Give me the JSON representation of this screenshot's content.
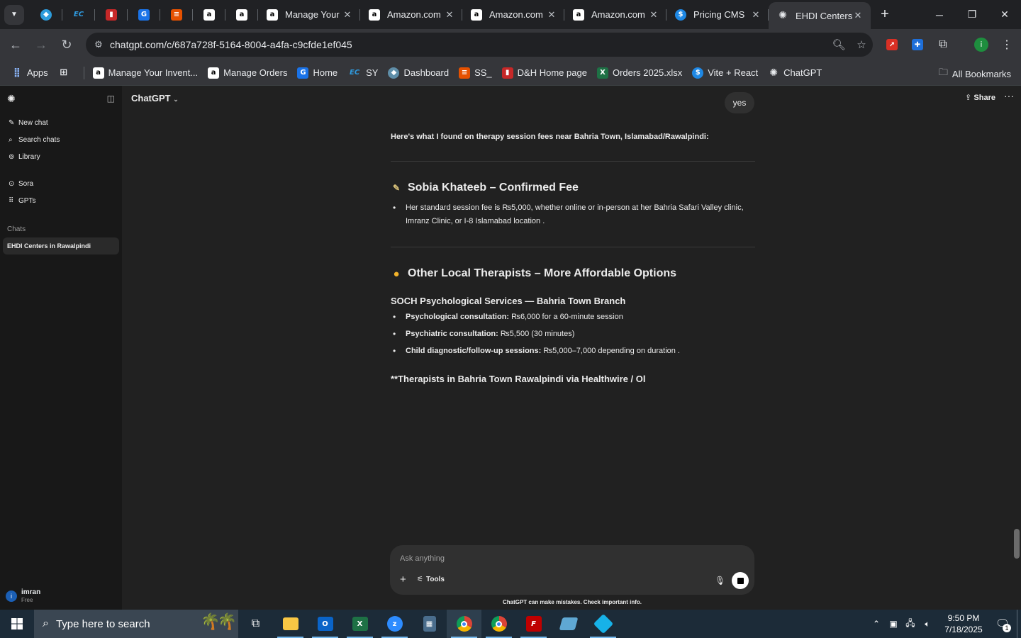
{
  "browser": {
    "pinned_tabs": [
      {
        "icon": "kodi-icon",
        "color": "#2d9cdb"
      },
      {
        "icon": "ec-icon",
        "color": "#1e88e5"
      },
      {
        "icon": "dh-icon",
        "color": "#c62828"
      },
      {
        "icon": "sheets-icon",
        "color": "#1a73e8"
      },
      {
        "icon": "stack-icon",
        "color": "#e65100"
      },
      {
        "icon": "amazon-icon",
        "color": "#ffffff"
      },
      {
        "icon": "amazon-icon",
        "color": "#ffffff"
      }
    ],
    "tabs": [
      {
        "title": "Manage Your",
        "icon": "amazon-icon"
      },
      {
        "title": "Amazon.com",
        "icon": "amazon-icon"
      },
      {
        "title": "Amazon.com",
        "icon": "amazon-icon"
      },
      {
        "title": "Amazon.com",
        "icon": "amazon-icon"
      },
      {
        "title": "Pricing CMS",
        "icon": "dollar-icon"
      },
      {
        "title": "EHDI Centers",
        "icon": "chatgpt-icon"
      }
    ],
    "url": "chatgpt.com/c/687a728f-5164-8004-a4fa-c9cfde1ef045",
    "bookmarks": [
      {
        "label": "Apps",
        "icon": "apps-grid-icon"
      },
      {
        "label": "",
        "icon": "tab-groups-icon"
      },
      {
        "label": "Manage Your Invent...",
        "icon": "amazon-icon"
      },
      {
        "label": "Manage Orders",
        "icon": "amazon-icon"
      },
      {
        "label": "Home",
        "icon": "home-icon"
      },
      {
        "label": "SY",
        "icon": "ec-icon"
      },
      {
        "label": "Dashboard",
        "icon": "dashboard-icon"
      },
      {
        "label": "SS_",
        "icon": "stack-icon"
      },
      {
        "label": "D&H Home page",
        "icon": "dh-icon"
      },
      {
        "label": "Orders 2025.xlsx",
        "icon": "excel-icon"
      },
      {
        "label": "Vite + React",
        "icon": "dollar-icon"
      },
      {
        "label": "ChatGPT",
        "icon": "chatgpt-icon"
      }
    ],
    "all_bookmarks": "All Bookmarks"
  },
  "sidebar": {
    "items": [
      {
        "label": "New chat",
        "icon": "compose-icon"
      },
      {
        "label": "Search chats",
        "icon": "search-icon"
      },
      {
        "label": "Library",
        "icon": "library-icon"
      }
    ],
    "items2": [
      {
        "label": "Sora",
        "icon": "sora-icon"
      },
      {
        "label": "GPTs",
        "icon": "gpts-icon"
      }
    ],
    "chats_label": "Chats",
    "chats": [
      "EHDI Centers in Rawalpindi"
    ],
    "user": {
      "initial": "i",
      "name": "imran",
      "plan": "Free"
    }
  },
  "header": {
    "model": "ChatGPT",
    "share": "Share"
  },
  "conversation": {
    "user_message": "yes",
    "intro": "Here's what I found on therapy session fees near Bahria Town, Islamabad/Rawalpindi:",
    "section1": {
      "title": "Sobia Khateeb – Confirmed Fee",
      "bullets": [
        "Her standard session fee is ₨5,000, whether online or in-person at her Bahria Safari Valley clinic, Imranz Clinic, or I-8 Islamabad location ."
      ]
    },
    "section2": {
      "title": "Other Local Therapists – More Affordable Options",
      "subheading": "SOCH Psychological Services — Bahria Town Branch",
      "bullets": [
        {
          "bold": "Psychological consultation:",
          "text": " ₨6,000 for a 60-minute session"
        },
        {
          "bold": "Psychiatric consultation:",
          "text": " ₨5,500 (30 minutes)"
        },
        {
          "bold": "Child diagnostic/follow-up sessions:",
          "text": " ₨5,000–7,000 depending on duration ."
        }
      ]
    },
    "partial_line": "**Therapists in Bahria Town Rawalpindi via Healthwire / Ol"
  },
  "composer": {
    "placeholder": "Ask anything",
    "tools": "Tools"
  },
  "disclaimer": "ChatGPT can make mistakes. Check important info.",
  "taskbar": {
    "search_placeholder": "Type here to search",
    "apps": [
      "task-view-icon",
      "file-explorer-icon",
      "outlook-icon",
      "excel-icon",
      "zoom-icon",
      "calculator-icon",
      "chrome-icon",
      "chrome-icon",
      "filezilla-icon",
      "notepad-icon",
      "kodi-icon"
    ],
    "time": "9:50 PM",
    "date": "7/18/2025",
    "notification_count": "1"
  }
}
